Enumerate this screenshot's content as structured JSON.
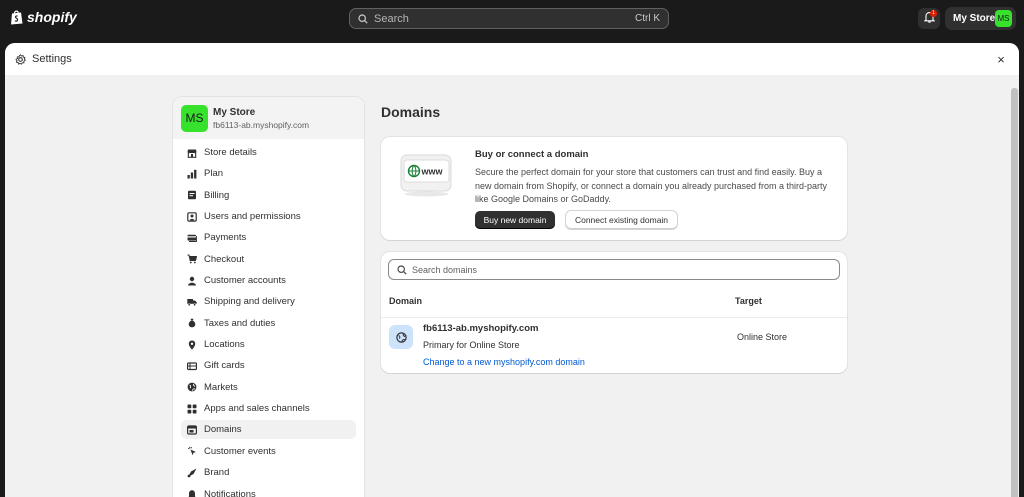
{
  "topbar": {
    "brand": "shopify",
    "search_placeholder": "Search",
    "search_shortcut": "Ctrl K",
    "notification_count": "1",
    "store_name": "My Store",
    "store_initials": "MS"
  },
  "modal": {
    "title": "Settings",
    "close_glyph": "×"
  },
  "sidebar": {
    "store_initials": "MS",
    "store_name": "My Store",
    "store_url": "fb6113-ab.myshopify.com",
    "items": [
      {
        "label": "Store details",
        "icon": "store-icon"
      },
      {
        "label": "Plan",
        "icon": "plan-chart-icon"
      },
      {
        "label": "Billing",
        "icon": "billing-icon"
      },
      {
        "label": "Users and permissions",
        "icon": "users-icon"
      },
      {
        "label": "Payments",
        "icon": "payments-icon"
      },
      {
        "label": "Checkout",
        "icon": "cart-icon"
      },
      {
        "label": "Customer accounts",
        "icon": "person-icon"
      },
      {
        "label": "Shipping and delivery",
        "icon": "truck-icon"
      },
      {
        "label": "Taxes and duties",
        "icon": "tax-bag-icon"
      },
      {
        "label": "Locations",
        "icon": "location-pin-icon"
      },
      {
        "label": "Gift cards",
        "icon": "gift-card-icon"
      },
      {
        "label": "Markets",
        "icon": "globe-icon"
      },
      {
        "label": "Apps and sales channels",
        "icon": "apps-icon"
      },
      {
        "label": "Domains",
        "icon": "domains-icon",
        "active": true
      },
      {
        "label": "Customer events",
        "icon": "cursor-click-icon"
      },
      {
        "label": "Brand",
        "icon": "brand-icon"
      },
      {
        "label": "Notifications",
        "icon": "bell-icon"
      }
    ]
  },
  "main": {
    "title": "Domains",
    "buy_card": {
      "illustration_text": "www",
      "heading": "Buy or connect a domain",
      "body": "Secure the perfect domain for your store that customers can trust and find easily. Buy a new domain from Shopify, or connect a domain you already purchased from a third-party like Google Domains or GoDaddy.",
      "primary_button": "Buy new domain",
      "secondary_button": "Connect existing domain"
    },
    "domains_card": {
      "search_placeholder": "Search domains",
      "columns": [
        "Domain",
        "Target"
      ],
      "rows": [
        {
          "domain": "fb6113-ab.myshopify.com",
          "subtitle": "Primary for Online Store",
          "link": "Change to a new myshopify.com domain",
          "target": "Online Store"
        }
      ]
    }
  },
  "colors": {
    "topbar_bg": "#1a1a1a",
    "avatar_green": "#36e22b",
    "primary_button": "#303030",
    "link_blue": "#005bd3",
    "globe_tile": "#cde3fb",
    "badge_red": "#e51c00"
  }
}
